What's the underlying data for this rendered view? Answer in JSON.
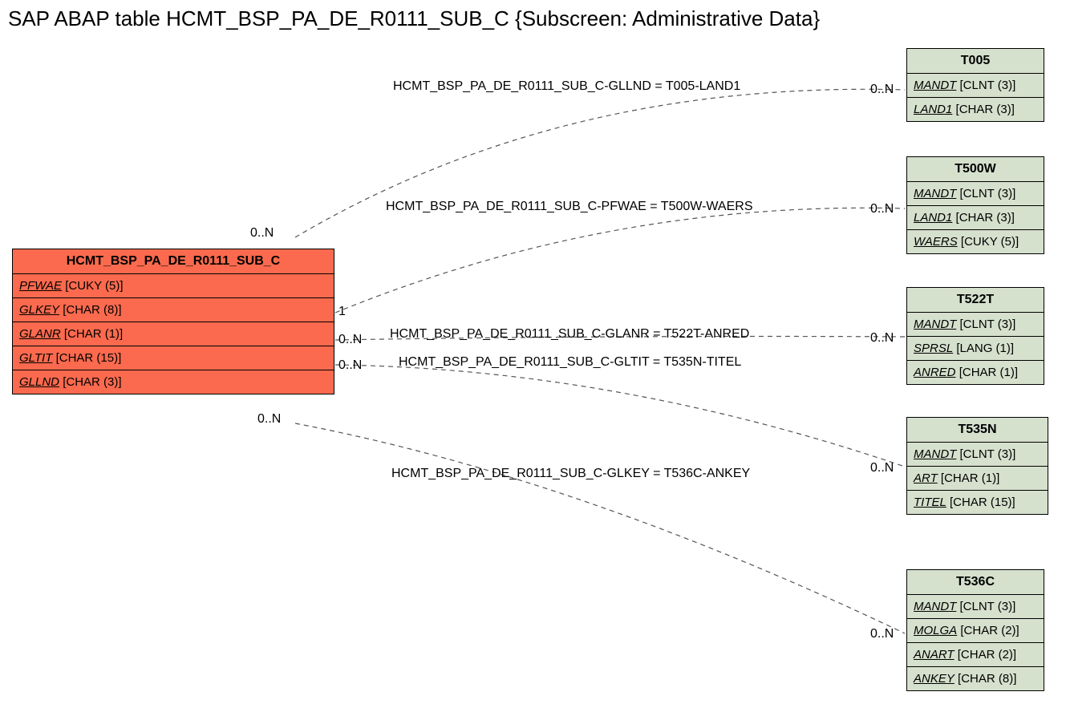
{
  "title": "SAP ABAP table HCMT_BSP_PA_DE_R0111_SUB_C {Subscreen: Administrative Data}",
  "main": {
    "name": "HCMT_BSP_PA_DE_R0111_SUB_C",
    "rows": [
      {
        "field": "PFWAE",
        "type": "[CUKY (5)]"
      },
      {
        "field": "GLKEY",
        "type": "[CHAR (8)]"
      },
      {
        "field": "GLANR",
        "type": "[CHAR (1)]"
      },
      {
        "field": "GLTIT",
        "type": "[CHAR (15)]"
      },
      {
        "field": "GLLND",
        "type": "[CHAR (3)]"
      }
    ]
  },
  "t005": {
    "name": "T005",
    "rows": [
      {
        "field": "MANDT",
        "type": "[CLNT (3)]"
      },
      {
        "field": "LAND1",
        "type": "[CHAR (3)]"
      }
    ]
  },
  "t500w": {
    "name": "T500W",
    "rows": [
      {
        "field": "MANDT",
        "type": "[CLNT (3)]"
      },
      {
        "field": "LAND1",
        "type": "[CHAR (3)]"
      },
      {
        "field": "WAERS",
        "type": "[CUKY (5)]"
      }
    ]
  },
  "t522t": {
    "name": "T522T",
    "rows": [
      {
        "field": "MANDT",
        "type": "[CLNT (3)]"
      },
      {
        "field": "SPRSL",
        "type": "[LANG (1)]"
      },
      {
        "field": "ANRED",
        "type": "[CHAR (1)]"
      }
    ]
  },
  "t535n": {
    "name": "T535N",
    "rows": [
      {
        "field": "MANDT",
        "type": "[CLNT (3)]"
      },
      {
        "field": "ART",
        "type": "[CHAR (1)]"
      },
      {
        "field": "TITEL",
        "type": "[CHAR (15)]"
      }
    ]
  },
  "t536c": {
    "name": "T536C",
    "rows": [
      {
        "field": "MANDT",
        "type": "[CLNT (3)]"
      },
      {
        "field": "MOLGA",
        "type": "[CHAR (2)]"
      },
      {
        "field": "ANART",
        "type": "[CHAR (2)]"
      },
      {
        "field": "ANKEY",
        "type": "[CHAR (8)]"
      }
    ]
  },
  "rel": {
    "r1": "HCMT_BSP_PA_DE_R0111_SUB_C-GLLND = T005-LAND1",
    "r2": "HCMT_BSP_PA_DE_R0111_SUB_C-PFWAE = T500W-WAERS",
    "r3": "HCMT_BSP_PA_DE_R0111_SUB_C-GLANR = T522T-ANRED",
    "r4": "HCMT_BSP_PA_DE_R0111_SUB_C-GLTIT = T535N-TITEL",
    "r5": "HCMT_BSP_PA_DE_R0111_SUB_C-GLKEY = T536C-ANKEY"
  },
  "card": {
    "zn": "0..N",
    "one": "1"
  }
}
